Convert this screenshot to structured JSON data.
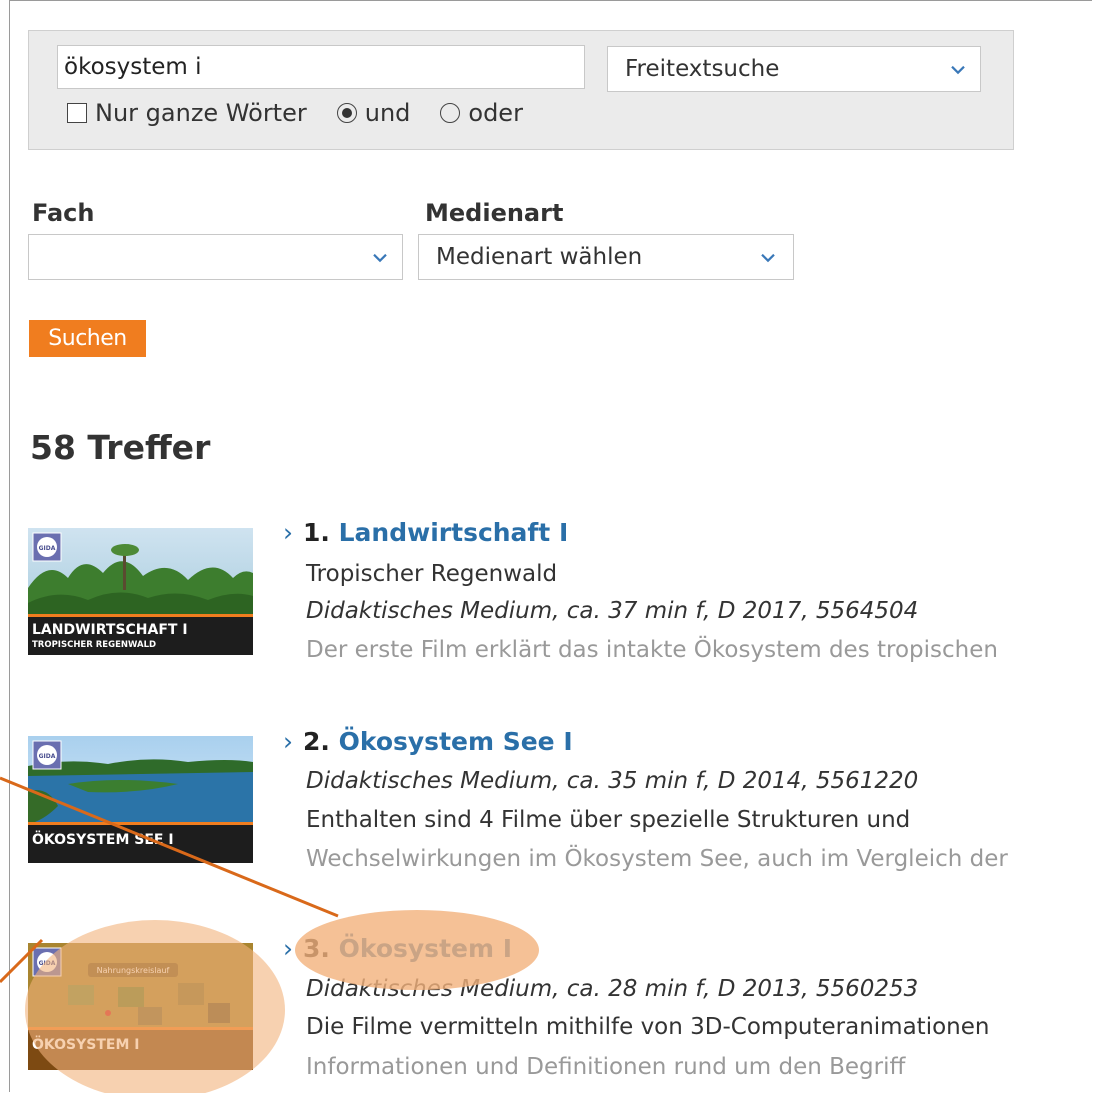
{
  "search": {
    "query": "ökosystem i",
    "mode_selected": "Freitextsuche",
    "whole_words_label": "Nur ganze Wörter",
    "and_label": "und",
    "or_label": "oder"
  },
  "filters": {
    "subject_label": "Fach",
    "subject_value": "",
    "media_label": "Medienart",
    "media_value": "Medienart wählen"
  },
  "search_button": "Suchen",
  "hits_count": "58 Treffer",
  "results": [
    {
      "number": "1.",
      "title": "Landwirtschaft I",
      "subtitle": "Tropischer Regenwald",
      "meta": "Didaktisches Medium, ca. 37 min f, D 2017, 5564504",
      "desc1": "Der erste Film erklärt das intakte Ökosystem des tropischen",
      "thumb_title": "LANDWIRTSCHAFT I",
      "thumb_sub": "TROPISCHER REGENWALD"
    },
    {
      "number": "2.",
      "title": "Ökosystem See I",
      "meta": "Didaktisches Medium, ca. 35 min f, D 2014, 5561220",
      "desc1": "Enthalten sind 4 Filme über spezielle Strukturen und",
      "desc2": "Wechselwirkungen im Ökosystem See, auch im Vergleich der",
      "thumb_title": "ÖKOSYSTEM SEE I"
    },
    {
      "number": "3.",
      "title": "Ökosystem I",
      "meta": "Didaktisches Medium, ca. 28 min f, D 2013, 5560253",
      "desc1": "Die Filme vermitteln mithilfe von 3D-Computeranimationen",
      "desc2": "Informationen und Definitionen rund um den Begriff",
      "thumb_title": "ÖKOSYSTEM I",
      "thumb_sub": "Nahrungskreislauf"
    }
  ],
  "logo_text": "GIDA",
  "colors": {
    "accent_orange": "#f07d1f",
    "link_blue": "#2a6fa8",
    "highlight": "#f2b27c",
    "annotation_line": "#d9691a"
  }
}
